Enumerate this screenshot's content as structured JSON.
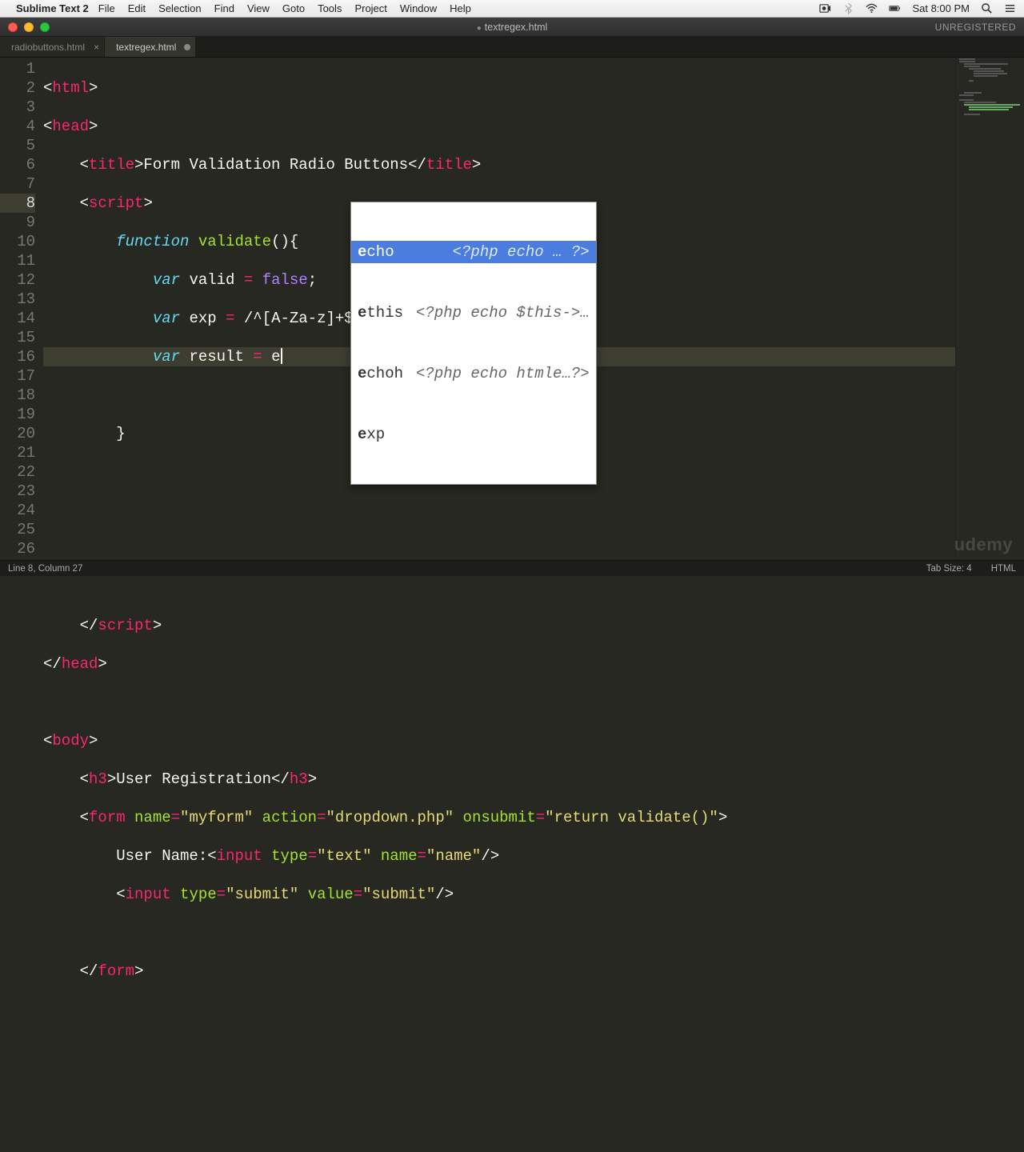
{
  "menubar": {
    "apple": "",
    "appname": "Sublime Text 2",
    "items": [
      "File",
      "Edit",
      "Selection",
      "Find",
      "View",
      "Goto",
      "Tools",
      "Project",
      "Window",
      "Help"
    ],
    "clock": "Sat 8:00 PM"
  },
  "window": {
    "title": "textregex.html",
    "unregistered": "UNREGISTERED"
  },
  "tabs": [
    {
      "label": "radiobuttons.html",
      "active": false,
      "modified": false
    },
    {
      "label": "textregex.html",
      "active": true,
      "modified": true
    }
  ],
  "editor": {
    "active_line": 8,
    "line_numbers": [
      "1",
      "2",
      "3",
      "4",
      "5",
      "6",
      "7",
      "8",
      "9",
      "10",
      "11",
      "12",
      "13",
      "14",
      "15",
      "16",
      "17",
      "18",
      "19",
      "20",
      "21",
      "22",
      "23",
      "24",
      "25",
      "26"
    ]
  },
  "code": {
    "l1_open": "<",
    "l1_tag": "html",
    "l1_close": ">",
    "l2_open": "<",
    "l2_tag": "head",
    "l2_close": ">",
    "l3_pre": "    <",
    "l3_tag": "title",
    "l3_mid": ">Form Validation Radio Buttons</",
    "l3_tag2": "title",
    "l3_end": ">",
    "l4_pre": "    <",
    "l4_tag": "script",
    "l4_end": ">",
    "l5_pre": "        ",
    "l5_func": "function",
    "l5_sp": " ",
    "l5_name": "validate",
    "l5_rest": "(){",
    "l6_pre": "            ",
    "l6_var": "var",
    "l6_sp": " ",
    "l6_valid": "valid ",
    "l6_eq": "=",
    "l6_sp2": " ",
    "l6_false": "false",
    "l6_semi": ";",
    "l7_pre": "            ",
    "l7_var": "var",
    "l7_sp": " ",
    "l7_exp": "exp ",
    "l7_eq": "=",
    "l7_rx": " /^[A-Za-z]+$/;",
    "l8_pre": "            ",
    "l8_var": "var",
    "l8_sp": " ",
    "l8_result": "result ",
    "l8_eq": "=",
    "l8_sp2": " ",
    "l8_e": "e",
    "l10_pre": "        }",
    "l15_pre": "    </",
    "l15_tag": "script",
    "l15_end": ">",
    "l16_pre": "</",
    "l16_tag": "head",
    "l16_end": ">",
    "l18_pre": "<",
    "l18_tag": "body",
    "l18_end": ">",
    "l19_pre": "    <",
    "l19_tag": "h3",
    "l19_mid": ">User Registration</",
    "l19_tag2": "h3",
    "l19_end": ">",
    "l20_pre": "    <",
    "l20_tag": "form",
    "l20_sp": " ",
    "l20_a1": "name",
    "l20_eq1": "=",
    "l20_v1": "\"myform\"",
    "l20_sp2": " ",
    "l20_a2": "action",
    "l20_eq2": "=",
    "l20_v2": "\"dropdown.php\"",
    "l20_sp3": " ",
    "l20_a3": "onsubmit",
    "l20_eq3": "=",
    "l20_v3": "\"return validate()\"",
    "l20_end": ">",
    "l21_pre": "        User Name:<",
    "l21_tag": "input",
    "l21_sp": " ",
    "l21_a1": "type",
    "l21_eq1": "=",
    "l21_v1": "\"text\"",
    "l21_sp2": " ",
    "l21_a2": "name",
    "l21_eq2": "=",
    "l21_v2": "\"name\"",
    "l21_end": "/>",
    "l22_pre": "        <",
    "l22_tag": "input",
    "l22_sp": " ",
    "l22_a1": "type",
    "l22_eq1": "=",
    "l22_v1": "\"submit\"",
    "l22_sp2": " ",
    "l22_a2": "value",
    "l22_eq2": "=",
    "l22_v2": "\"submit\"",
    "l22_end": "/>",
    "l24_pre": "    </",
    "l24_tag": "form",
    "l24_end": ">"
  },
  "autocomplete": {
    "items": [
      {
        "key_prefix": "e",
        "key_rest": "cho",
        "hint": "<?php echo … ?>",
        "selected": true
      },
      {
        "key_prefix": "e",
        "key_rest": "this",
        "hint": "<?php echo $this->…",
        "selected": false
      },
      {
        "key_prefix": "e",
        "key_rest": "choh",
        "hint": "<?php echo htmle…?>",
        "selected": false
      },
      {
        "key_prefix": "e",
        "key_rest": "xp",
        "hint": "",
        "selected": false
      }
    ]
  },
  "statusbar": {
    "left": "Line 8, Column 27",
    "tabsize": "Tab Size: 4",
    "lang": "HTML"
  },
  "watermark": "udemy"
}
